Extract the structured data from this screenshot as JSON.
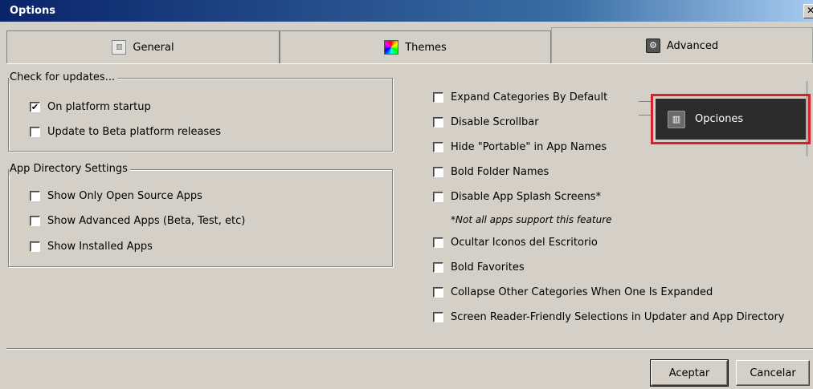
{
  "window": {
    "title": "Options"
  },
  "tabs": {
    "general": {
      "label": "General",
      "icon": "sliders-icon"
    },
    "themes": {
      "label": "Themes",
      "icon": "palette-icon"
    },
    "advanced": {
      "label": "Advanced",
      "icon": "advanced-settings-icon",
      "active": true
    }
  },
  "updates_group": {
    "title": "Check for updates...",
    "items": [
      {
        "label": "On platform startup",
        "checked": true
      },
      {
        "label": "Update to Beta platform releases",
        "checked": false
      }
    ]
  },
  "app_directory_group": {
    "title": "App Directory Settings",
    "items": [
      {
        "label": "Show Only Open Source Apps",
        "checked": false
      },
      {
        "label": "Show Advanced Apps (Beta, Test, etc)",
        "checked": false
      },
      {
        "label": "Show Installed Apps",
        "checked": false
      }
    ]
  },
  "right_options": {
    "items": [
      {
        "label": "Expand Categories By Default",
        "checked": false
      },
      {
        "label": "Disable Scrollbar",
        "checked": false
      },
      {
        "label": "Hide \"Portable\" in App Names",
        "checked": false
      },
      {
        "label": "Bold Folder Names",
        "checked": false
      },
      {
        "label": "Disable App Splash Screens*",
        "checked": false
      },
      {
        "label": "Ocultar Iconos del Escritorio",
        "checked": false
      },
      {
        "label": "Bold Favorites",
        "checked": false
      },
      {
        "label": "Collapse Other Categories When One Is Expanded",
        "checked": false
      },
      {
        "label": "Screen Reader-Friendly Selections in Updater and App Directory",
        "checked": false
      }
    ],
    "note": "*Not all apps support this feature"
  },
  "tooltip": {
    "label": "Opciones",
    "icon": "sliders-icon",
    "highlight_color": "#d6202a"
  },
  "buttons": {
    "accept": "Aceptar",
    "cancel": "Cancelar"
  }
}
